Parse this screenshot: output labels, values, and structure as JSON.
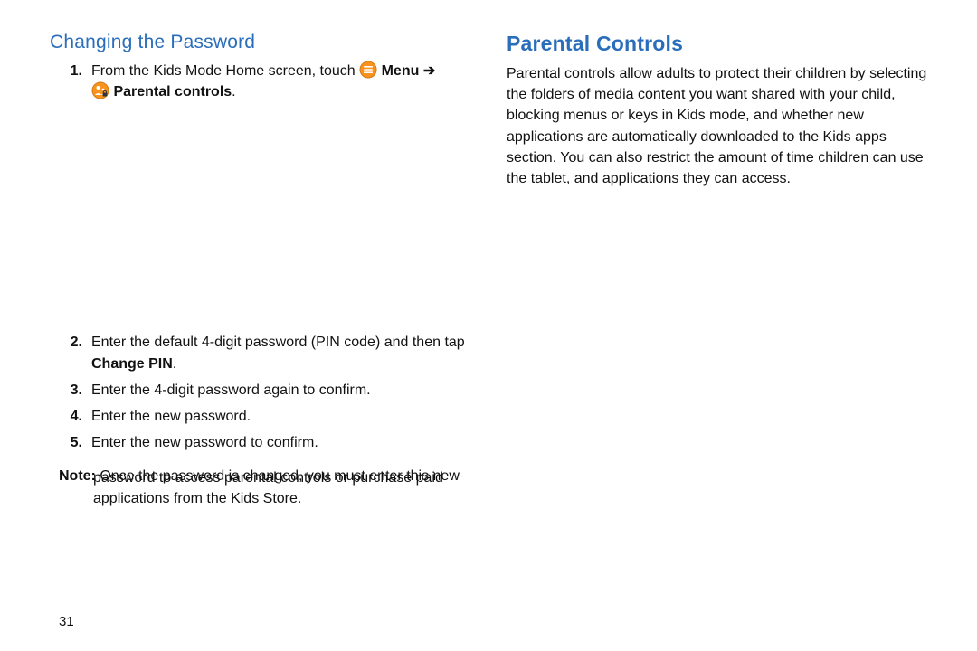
{
  "left": {
    "heading": "Changing the Password",
    "step1_prefix": "From the Kids Mode Home screen, touch",
    "step1_menu": "Menu",
    "step1_arrow": "➔",
    "step1_parental": "Parental controls",
    "step2_a": "Enter the default 4-digit password (PIN code) and then tap ",
    "step2_b": "Change PIN",
    "step2_c": ".",
    "step3": "Enter the 4-digit password again to confirm.",
    "step4": "Enter the new password.",
    "step5": "Enter the new password to confirm.",
    "note_label": "Note:",
    "note_lead": " Once the password is changed, you must enter this new",
    "note_rest": "password to access parental controls or purchase paid applications from the Kids Store.",
    "pagenum": "31"
  },
  "right": {
    "heading": "Parental Controls",
    "para": "Parental controls allow adults to protect their children by selecting the folders of media content you want shared with your child, blocking menus or keys in Kids mode, and whether new applications are automatically downloaded to the Kids apps section. You can also restrict the amount of time children can use the tablet, and applications they can access."
  },
  "nums": {
    "n1": "1.",
    "n2": "2.",
    "n3": "3.",
    "n4": "4.",
    "n5": "5."
  }
}
